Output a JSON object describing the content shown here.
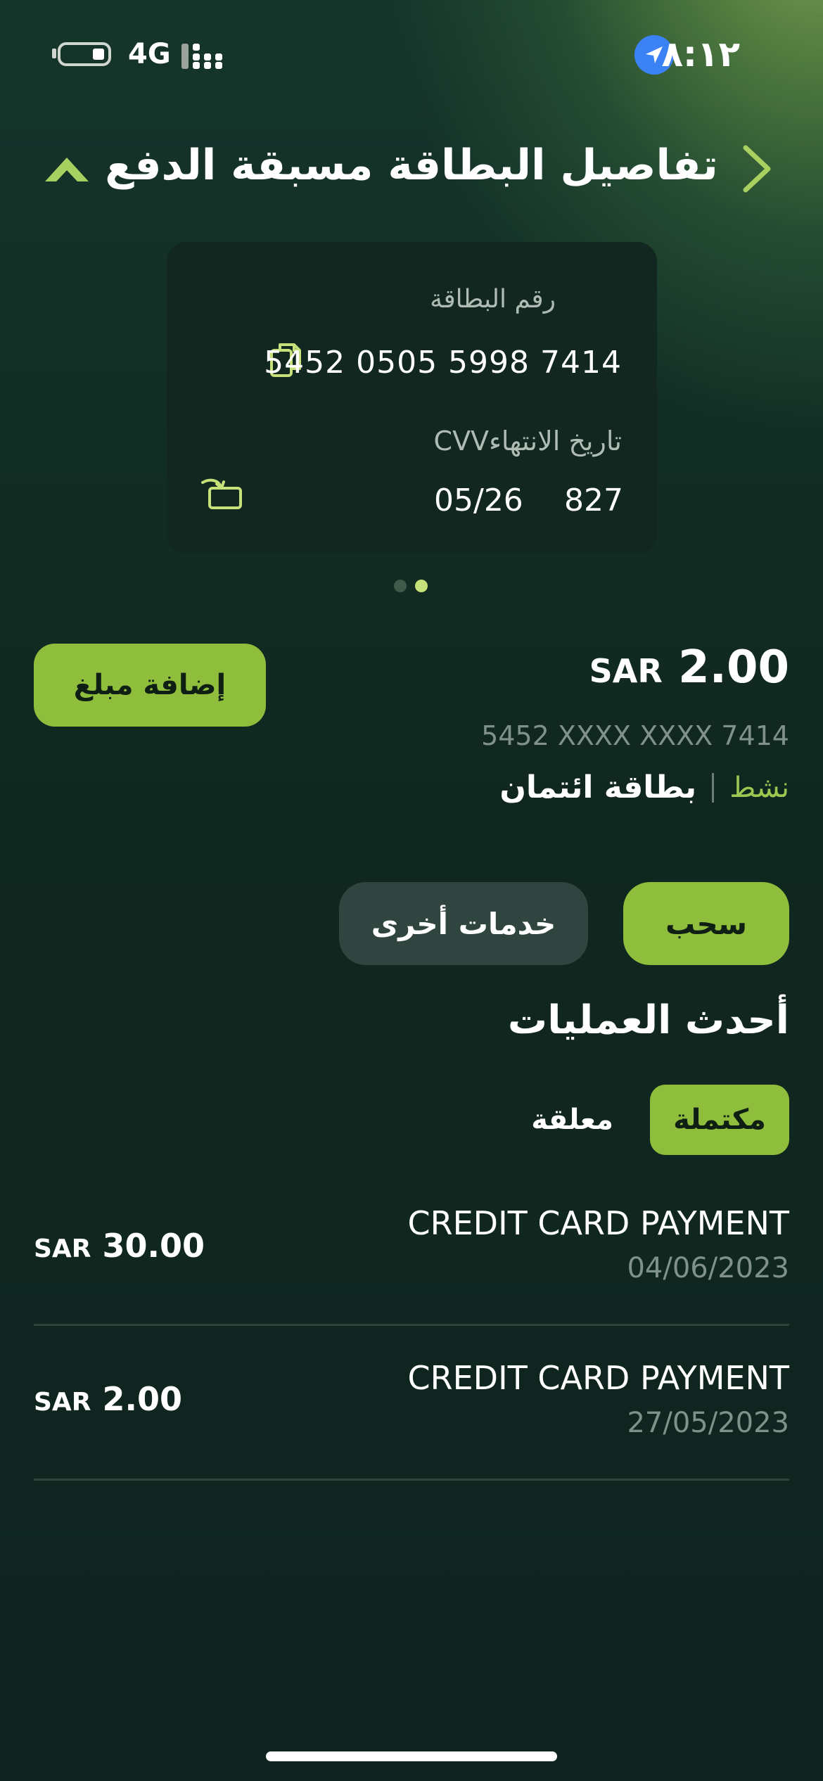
{
  "status_bar": {
    "time": "٨:١٢",
    "network": "4G"
  },
  "header": {
    "title": "تفاصيل البطاقة مسبقة الدفع"
  },
  "card": {
    "number_label": "رقم البطاقة",
    "number": "5452 0505 5998 7414",
    "expiry_cvv_label": "تاريخ الانتهاءCVV",
    "expiry": "05/26",
    "cvv": "827",
    "page_count": 2,
    "active_page": 2
  },
  "balance": {
    "currency": "SAR",
    "amount": "2.00",
    "masked_number": "5452 XXXX XXXX 7414",
    "card_type": "بطاقة ائتمان",
    "status": "نشط"
  },
  "buttons": {
    "add_amount": "إضافة مبلغ",
    "withdraw": "سحب",
    "other_services": "خدمات أخرى"
  },
  "transactions_section": {
    "title": "أحدث العمليات",
    "tabs": [
      {
        "label": "مكتملة",
        "selected": true
      },
      {
        "label": "معلقة",
        "selected": false
      }
    ],
    "items": [
      {
        "title": "CREDIT CARD PAYMENT",
        "date": "04/06/2023",
        "currency": "SAR",
        "amount": "30.00"
      },
      {
        "title": "CREDIT CARD PAYMENT",
        "date": "27/05/2023",
        "currency": "SAR",
        "amount": "2.00"
      }
    ]
  },
  "colors": {
    "accent": "#8fbe3d",
    "background": "#0f2420",
    "card": "#11271f",
    "muted_text": "#7f918a"
  }
}
